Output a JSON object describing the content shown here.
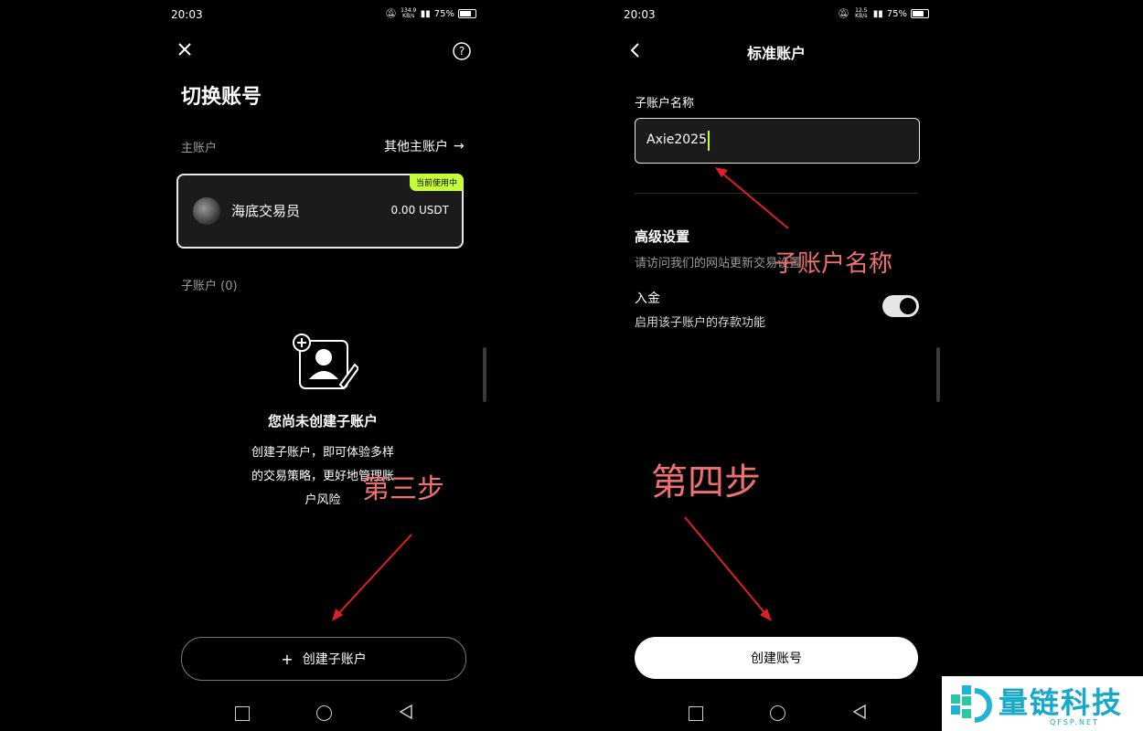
{
  "left": {
    "status": {
      "time": "20:03",
      "speed": "134.9 KB/s",
      "battery": "75%"
    },
    "title": "切换账号",
    "main_account_label": "主账户",
    "other_accounts_link": "其他主账户",
    "account_card": {
      "name": "海底交易员",
      "balance": "0.00 USDT",
      "badge": "当前使用中"
    },
    "sub_accounts_label": "子账户 (0)",
    "empty_title": "您尚未创建子账户",
    "empty_desc_lines": [
      "创建子账户，即可体验多样",
      "的交易策略，更好地管理账",
      "户风险"
    ],
    "create_button": "创建子账户",
    "annotation": "第三步"
  },
  "right": {
    "status": {
      "time": "20:03",
      "speed": "12.5 KB/s",
      "battery": "75%"
    },
    "title": "标准账户",
    "name_label": "子账户名称",
    "name_value": "Axie2025",
    "advanced_title": "高级设置",
    "advanced_desc": "请访问我们的网站更新交易设置",
    "deposit_title": "入金",
    "deposit_desc": "启用该子账户的存款功能",
    "deposit_enabled": true,
    "create_button": "创建账号",
    "annotation_name": "子账户名称",
    "annotation_step": "第四步"
  },
  "watermark": {
    "brand": "量链科技",
    "domain": "QFSP.NET"
  },
  "colors": {
    "accent": "#c6ff3a",
    "annotation": "#f07070",
    "background": "#000000"
  }
}
